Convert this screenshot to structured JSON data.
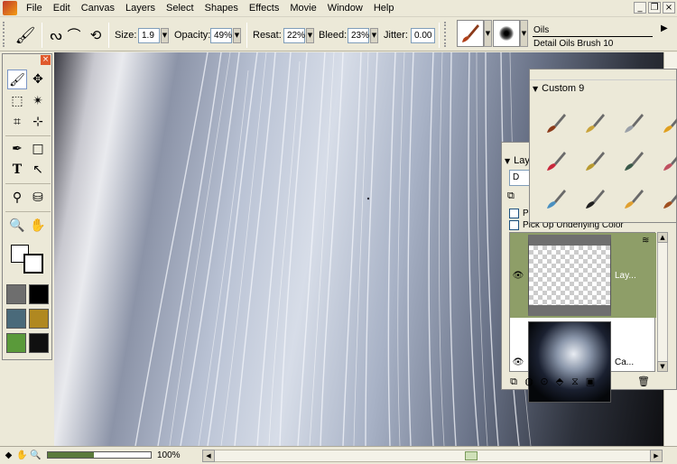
{
  "menu": {
    "items": [
      "File",
      "Edit",
      "Canvas",
      "Layers",
      "Select",
      "Shapes",
      "Effects",
      "Movie",
      "Window",
      "Help"
    ]
  },
  "window_controls": {
    "minimize": "_",
    "restore": "❐",
    "close": "×"
  },
  "property_bar": {
    "size_label": "Size:",
    "size_value": "1.9",
    "opacity_label": "Opacity:",
    "opacity_value": "49%",
    "resat_label": "Resat:",
    "resat_value": "22%",
    "bleed_label": "Bleed:",
    "bleed_value": "23%",
    "jitter_label": "Jitter:",
    "jitter_value": "0.00",
    "brush_category": "Oils",
    "brush_variant": "Detail Oils Brush 10"
  },
  "toolbox": {
    "tools": [
      "brush",
      "move-layer",
      "rect-select",
      "magic-wand",
      "crop",
      "lasso-transform",
      "pen",
      "rectangle",
      "text",
      "shape-select",
      "dropper",
      "paint-bucket",
      "magnifier",
      "grabber"
    ],
    "swatches": [
      "#6e6e6e",
      "#000000",
      "#4a6a7a",
      "#b08820",
      "#5a9a3a",
      "#101010"
    ]
  },
  "status_bar": {
    "zoom_value": 0.45,
    "zoom_text": "100%"
  },
  "custom_palette": {
    "title": "Custom  9",
    "colors": [
      "#8b3a1a",
      "#c9a33a",
      "#9aa0a8",
      "#e0a020",
      "#c8283c",
      "#b89a30",
      "#3a5a4a",
      "#c05060",
      "#4a90c0",
      "#202020",
      "#e0a030",
      "#a05020"
    ]
  },
  "layers_palette": {
    "title": "Lay",
    "composite": "D",
    "option1": "Pr",
    "option2": "Pick Up Underlying Color",
    "layers": [
      {
        "name": "Lay...",
        "selected": true
      },
      {
        "name": "Ca...",
        "selected": false
      }
    ]
  }
}
